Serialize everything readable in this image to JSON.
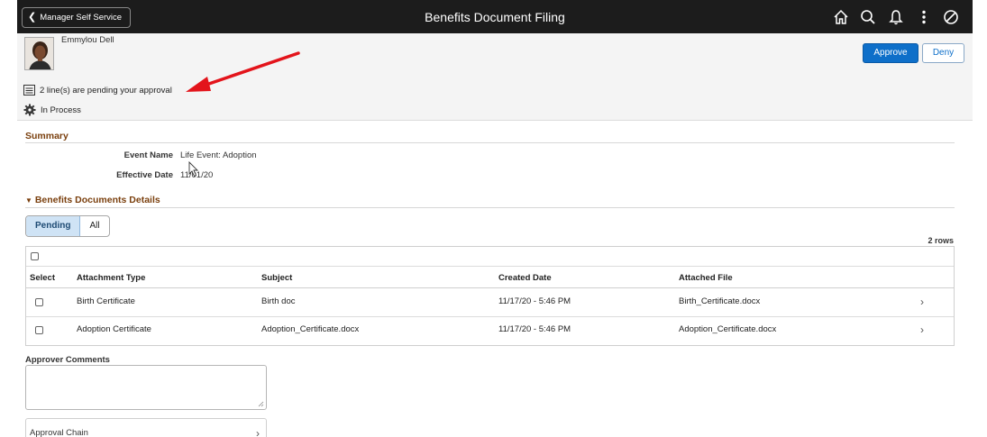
{
  "banner": {
    "back_label": "Manager Self Service",
    "title": "Benefits Document Filing",
    "icons": [
      "home-icon",
      "search-icon",
      "bell-icon",
      "more-options-icon",
      "navbar-icon"
    ]
  },
  "header": {
    "employee_name": "Emmylou Dell",
    "pending_text": "2 line(s) are pending your approval",
    "status_text": "In Process",
    "approve_label": "Approve",
    "deny_label": "Deny"
  },
  "summary": {
    "title": "Summary",
    "event_name_label": "Event Name",
    "event_name_value": "Life Event: Adoption",
    "effective_date_label": "Effective Date",
    "effective_date_value": "11/01/20"
  },
  "details": {
    "title": "Benefits Documents Details",
    "tabs": [
      "Pending",
      "All"
    ],
    "rows_count": "2 rows",
    "columns": [
      "Select",
      "Attachment Type",
      "Subject",
      "Created Date",
      "Attached File"
    ],
    "rows": [
      {
        "attachment_type": "Birth Certificate",
        "subject": "Birth doc",
        "created": "11/17/20 - 5:46 PM",
        "file": "Birth_Certificate.docx"
      },
      {
        "attachment_type": "Adoption Certificate",
        "subject": "Adoption_Certificate.docx",
        "created": "11/17/20 - 5:46 PM",
        "file": "Adoption_Certificate.docx"
      }
    ]
  },
  "comments": {
    "label": "Approver Comments",
    "value": ""
  },
  "approval_chain": {
    "label": "Approval Chain"
  },
  "colors": {
    "banner_bg": "#1c1c1c",
    "accent_blue": "#0e6fc9",
    "section_title": "#7a3f0d",
    "annotation_arrow": "#e3141b"
  }
}
